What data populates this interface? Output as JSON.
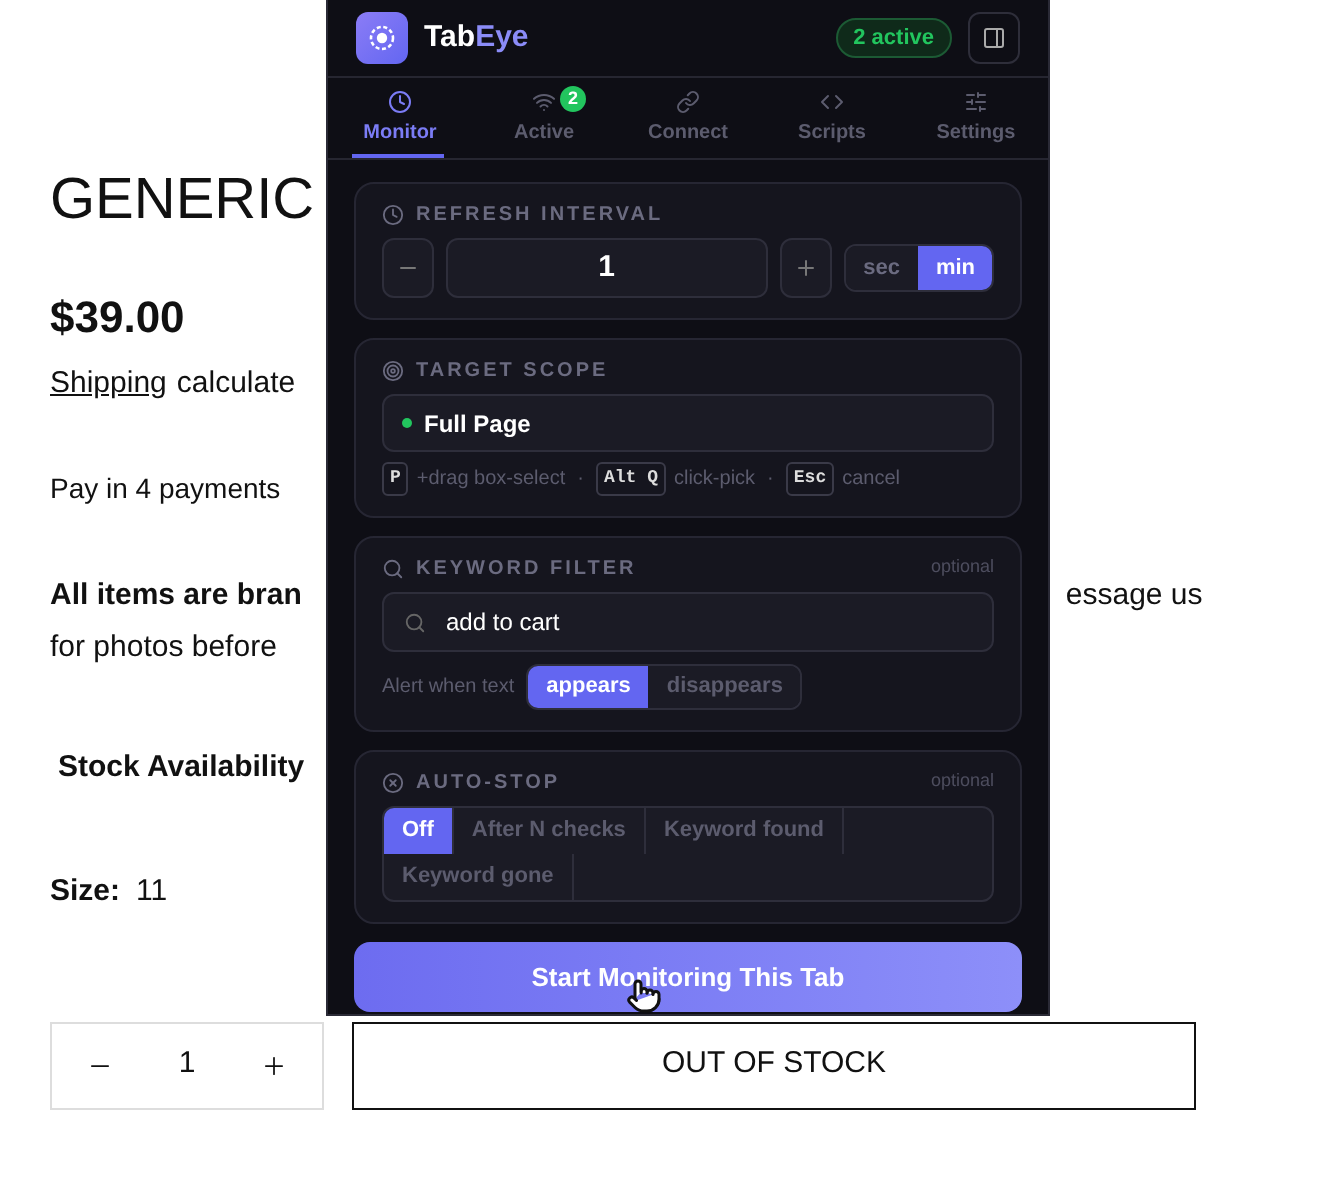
{
  "page": {
    "title": "GENERIC",
    "price": "$39.00",
    "shipping_link": "Shipping",
    "shipping_text": "calculate",
    "payments": "Pay in 4 payments",
    "notice_left": "All items are bran",
    "notice_right": "essage us",
    "notice_line2": "for photos before",
    "stock_label": "Stock Availability",
    "size_label": "Size:",
    "size_value": "11",
    "quantity": "1",
    "stock_button": "OUT OF STOCK"
  },
  "extension": {
    "name_parts": [
      "Tab",
      "Eye"
    ],
    "status_badge": "2 active",
    "tabs": [
      {
        "label": "Monitor",
        "selected": true
      },
      {
        "label": "Active",
        "selected": false,
        "badge": "2"
      },
      {
        "label": "Connect",
        "selected": false
      },
      {
        "label": "Scripts",
        "selected": false
      },
      {
        "label": "Settings",
        "selected": false
      }
    ],
    "refresh": {
      "title": "REFRESH INTERVAL",
      "value": "1",
      "units": [
        {
          "label": "sec",
          "selected": false
        },
        {
          "label": "min",
          "selected": true
        }
      ]
    },
    "scope": {
      "title": "TARGET SCOPE",
      "value": "Full Page",
      "separator": "·",
      "hints": [
        {
          "key": "P",
          "text": "+drag box-select"
        },
        {
          "key": "Alt Q",
          "text": "click-pick"
        },
        {
          "key": "Esc",
          "text": "cancel"
        }
      ]
    },
    "keyword": {
      "title": "KEYWORD FILTER",
      "note": "optional",
      "value": "add to cart",
      "alert_label": "Alert when text",
      "modes": [
        {
          "label": "appears",
          "selected": true
        },
        {
          "label": "disappears",
          "selected": false
        }
      ]
    },
    "auto_stop": {
      "title": "AUTO-STOP",
      "note": "optional",
      "options": [
        {
          "label": "Off",
          "selected": true
        },
        {
          "label": "After N checks",
          "selected": false
        },
        {
          "label": "Keyword found",
          "selected": false
        },
        {
          "label": "Keyword gone",
          "selected": false
        }
      ]
    },
    "start_button": "Start Monitoring This Tab"
  }
}
